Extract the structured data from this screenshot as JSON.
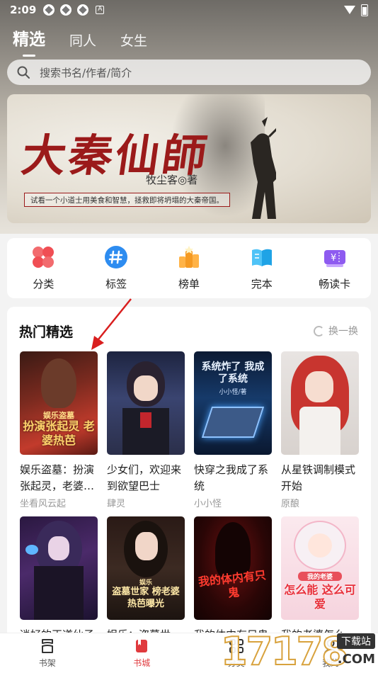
{
  "status_bar": {
    "time": "2:09",
    "a_badge": "A"
  },
  "top_tabs": [
    {
      "label": "精选",
      "active": true
    },
    {
      "label": "同人",
      "active": false
    },
    {
      "label": "女生",
      "active": false
    }
  ],
  "search": {
    "placeholder": "搜索书名/作者/简介"
  },
  "banner": {
    "title": "大秦仙師",
    "author": "牧尘客◎著",
    "tagline": "试看一个小道士用美食和智慧，拯救即将坍塌的大秦帝国。"
  },
  "quick_menu": [
    {
      "label": "分类",
      "icon": "category-icon",
      "color": "#f0555b"
    },
    {
      "label": "标签",
      "icon": "hashtag-icon",
      "color": "#2d8cf0"
    },
    {
      "label": "榜单",
      "icon": "ranking-icon",
      "color": "#f59a23"
    },
    {
      "label": "完本",
      "icon": "open-book-icon",
      "color": "#1fa3e6"
    },
    {
      "label": "畅读卡",
      "icon": "ticket-icon",
      "color": "#8e5bf0"
    }
  ],
  "hot_section": {
    "title": "热门精选",
    "swap_label": "换一换",
    "books": [
      {
        "title": "娱乐盗墓：扮演张起灵，老婆…",
        "author": "坐看风云起",
        "cover_text": "扮演张起灵 老婆热芭",
        "cover_badge": "娱乐盗墓"
      },
      {
        "title": "少女们，欢迎来到欲望巴士",
        "author": "肆灵",
        "cover_text": "",
        "cover_badge": ""
      },
      {
        "title": "快穿之我成了系统",
        "author": "小小怪",
        "cover_text": "系统炸了 我成了系统",
        "cover_badge": "小小怪/著"
      },
      {
        "title": "从星铁调制模式开始",
        "author": "原酿",
        "cover_text": "",
        "cover_badge": ""
      },
      {
        "title": "逍好的正道仙子",
        "author": "",
        "cover_text": "",
        "cover_badge": ""
      },
      {
        "title": "娱乐：盗墓世…",
        "author": "",
        "cover_text": "盗墓世家 榜老婆热芭曝光",
        "cover_badge": "娱乐"
      },
      {
        "title": "我的体内有只鬼",
        "author": "",
        "cover_text": "我的体内有只鬼",
        "cover_badge": ""
      },
      {
        "title": "我的老婆怎么能…",
        "author": "",
        "cover_text": "怎么能 这么可爱",
        "cover_badge": "我的老婆"
      }
    ]
  },
  "bottom_nav": [
    {
      "label": "书架",
      "icon": "bookshelf-icon",
      "active": false
    },
    {
      "label": "书城",
      "icon": "bookstore-icon",
      "active": true
    },
    {
      "label": "分类",
      "icon": "grid-icon",
      "active": false
    },
    {
      "label": "我的",
      "icon": "profile-icon",
      "active": false
    }
  ],
  "watermark": {
    "number": "17178",
    "tag": "下载站",
    "domain": ".COM"
  }
}
